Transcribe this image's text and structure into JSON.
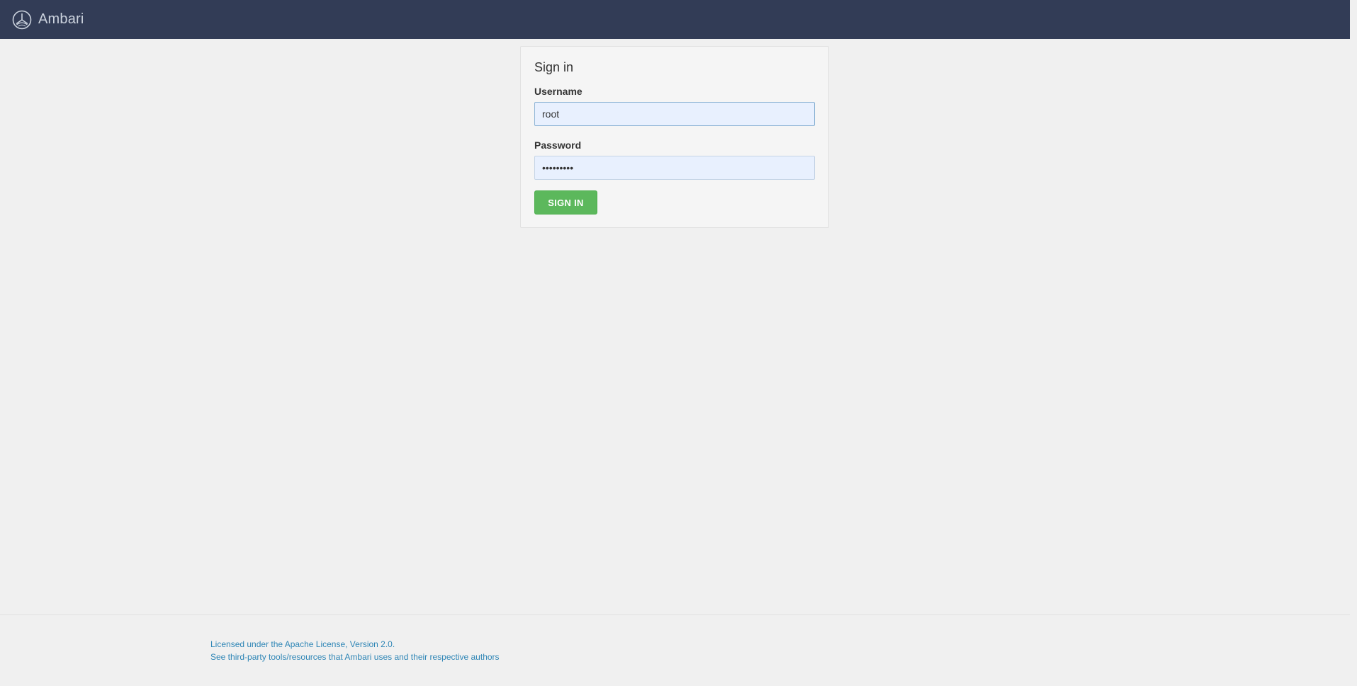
{
  "navbar": {
    "brand_name": "Ambari",
    "logo_icon": "ambari-logo-icon",
    "background": "#323c56"
  },
  "login": {
    "title": "Sign in",
    "username_label": "Username",
    "username_value": "root",
    "password_label": "Password",
    "password_value": "•••••••••",
    "submit_label": "SIGN IN",
    "submit_color": "#5cb85c"
  },
  "footer": {
    "license_link": "Licensed under the Apache License, Version 2.0.",
    "third_party_link": "See third-party tools/resources that Ambari uses and their respective authors",
    "link_color": "#2f86b6"
  }
}
